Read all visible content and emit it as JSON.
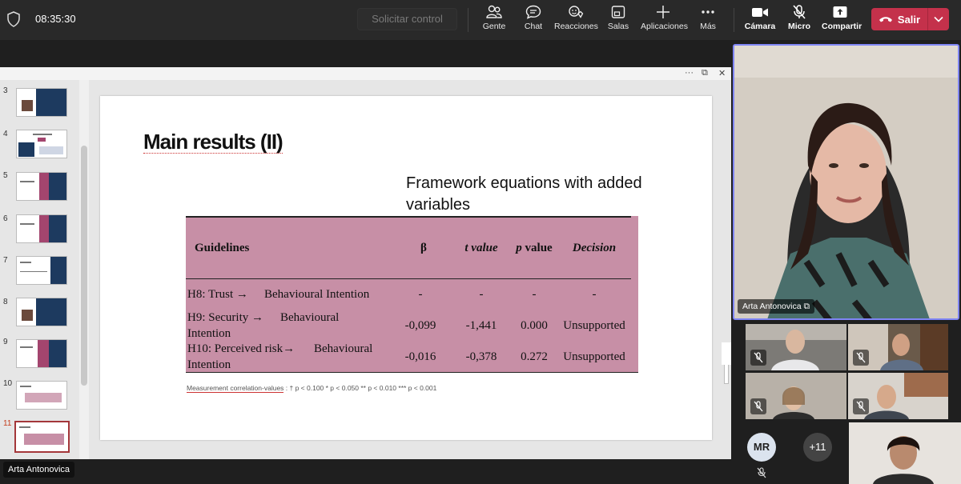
{
  "topbar": {
    "clock": "08:35:30",
    "request_control": "Solicitar control",
    "tools": [
      {
        "label": "Gente",
        "icon": "people-icon"
      },
      {
        "label": "Chat",
        "icon": "chat-icon"
      },
      {
        "label": "Reacciones",
        "icon": "reactions-icon"
      },
      {
        "label": "Salas",
        "icon": "rooms-icon"
      },
      {
        "label": "Aplicaciones",
        "icon": "plus-icon"
      },
      {
        "label": "Más",
        "icon": "more-icon"
      },
      {
        "label": "Cámara",
        "icon": "camera-icon"
      },
      {
        "label": "Micro",
        "icon": "mic-off-icon"
      },
      {
        "label": "Compartir",
        "icon": "share-icon"
      }
    ],
    "leave": "Salir"
  },
  "slides": {
    "numbers": [
      "3",
      "4",
      "5",
      "6",
      "7",
      "8",
      "9",
      "10",
      "11"
    ],
    "active": "11"
  },
  "slide": {
    "title": "Main results (II)",
    "subtitle": "Framework equations with added variables",
    "table": {
      "headers": [
        "Guidelines",
        "β",
        "t value",
        "p value",
        "Decision"
      ],
      "rows": [
        {
          "guideline_a": "H8: Trust →",
          "guideline_b": "Behavioural Intention",
          "guideline_c": "",
          "beta": "-",
          "t": "-",
          "p": "-",
          "decision": "-"
        },
        {
          "guideline_a": "H9: Security →",
          "guideline_b": "Behavioural",
          "guideline_c": "Intention",
          "beta": "-0,099",
          "t": "-1,441",
          "p": "0.000",
          "decision": "Unsupported"
        },
        {
          "guideline_a": "H10: Perceived risk→",
          "guideline_b": "Behavioural",
          "guideline_c": "Intention",
          "beta": "-0,016",
          "t": "-0,378",
          "p": "0.272",
          "decision": "Unsupported"
        }
      ]
    },
    "footnote_link": "Measurement correlation-values",
    "footnote_rest": " : † p < 0.100 * p < 0.050   ** p < 0.010   *** p < 0.001"
  },
  "presenter_name": "Arta Antonovica",
  "main_video_name": "Arta Antonovica",
  "participants": {
    "avatar_initials": "MR",
    "more_count": "+11"
  },
  "colors": {
    "table_bg": "#c78fa6",
    "leave_btn": "#c4314b",
    "active_speaker_border": "#7f85f5"
  }
}
